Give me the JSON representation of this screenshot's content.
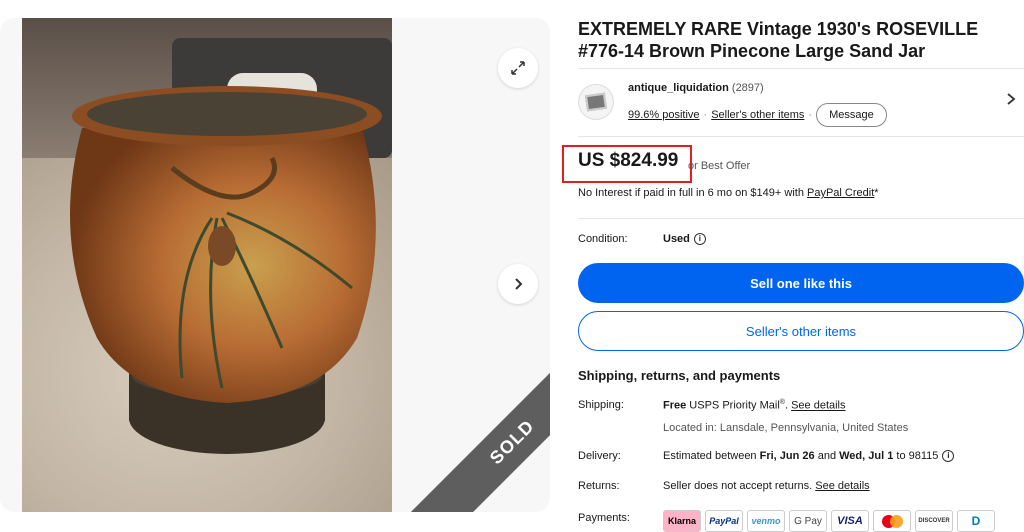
{
  "listing": {
    "title": "EXTREMELY RARE Vintage 1930's ROSEVILLE #776-14 Brown Pinecone Large Sand Jar",
    "sold_label": "SOLD"
  },
  "gallery": {
    "expand_icon": "expand-icon",
    "next_icon": "chevron-right-icon"
  },
  "seller": {
    "name": "antique_liquidation",
    "count": "(2897)",
    "positive": "99.6% positive",
    "other_items": "Seller's other items",
    "separator": "·",
    "message_label": "Message"
  },
  "price": {
    "amount": "US $824.99",
    "best_offer": "or Best Offer",
    "paypal_prefix": "No Interest if paid in full in 6 mo on $149+ with ",
    "paypal_link": "PayPal Credit",
    "paypal_suffix": "*"
  },
  "condition": {
    "label": "Condition:",
    "value": "Used",
    "info": "i"
  },
  "actions": {
    "sell_like": "Sell one like this",
    "other_items": "Seller's other items"
  },
  "shipping": {
    "heading": "Shipping, returns, and payments",
    "shipping_label": "Shipping:",
    "shipping_free": "Free",
    "shipping_service": " USPS Priority Mail",
    "shipping_reg": "®",
    "shipping_period": ". ",
    "see_details": "See details",
    "location": "Located in: Lansdale, Pennsylvania, United States",
    "delivery_label": "Delivery:",
    "delivery_prefix": "Estimated between ",
    "delivery_start": "Fri, Jun 26",
    "delivery_and": " and ",
    "delivery_end": "Wed, Jul 1",
    "delivery_suffix": " to 98115",
    "returns_label": "Returns:",
    "returns_text": "Seller does not accept returns. ",
    "returns_link": "See details",
    "payments_label": "Payments:"
  },
  "payments": {
    "klarna": "Klarna",
    "paypal": "PayPal",
    "venmo": "venmo",
    "gpay": "G Pay",
    "visa": "VISA",
    "discover": "DISCOVER",
    "diners": "D"
  },
  "colors": {
    "primary": "#0064f0",
    "highlight": "#e0201f",
    "sold_ribbon": "#5e5e5e"
  }
}
